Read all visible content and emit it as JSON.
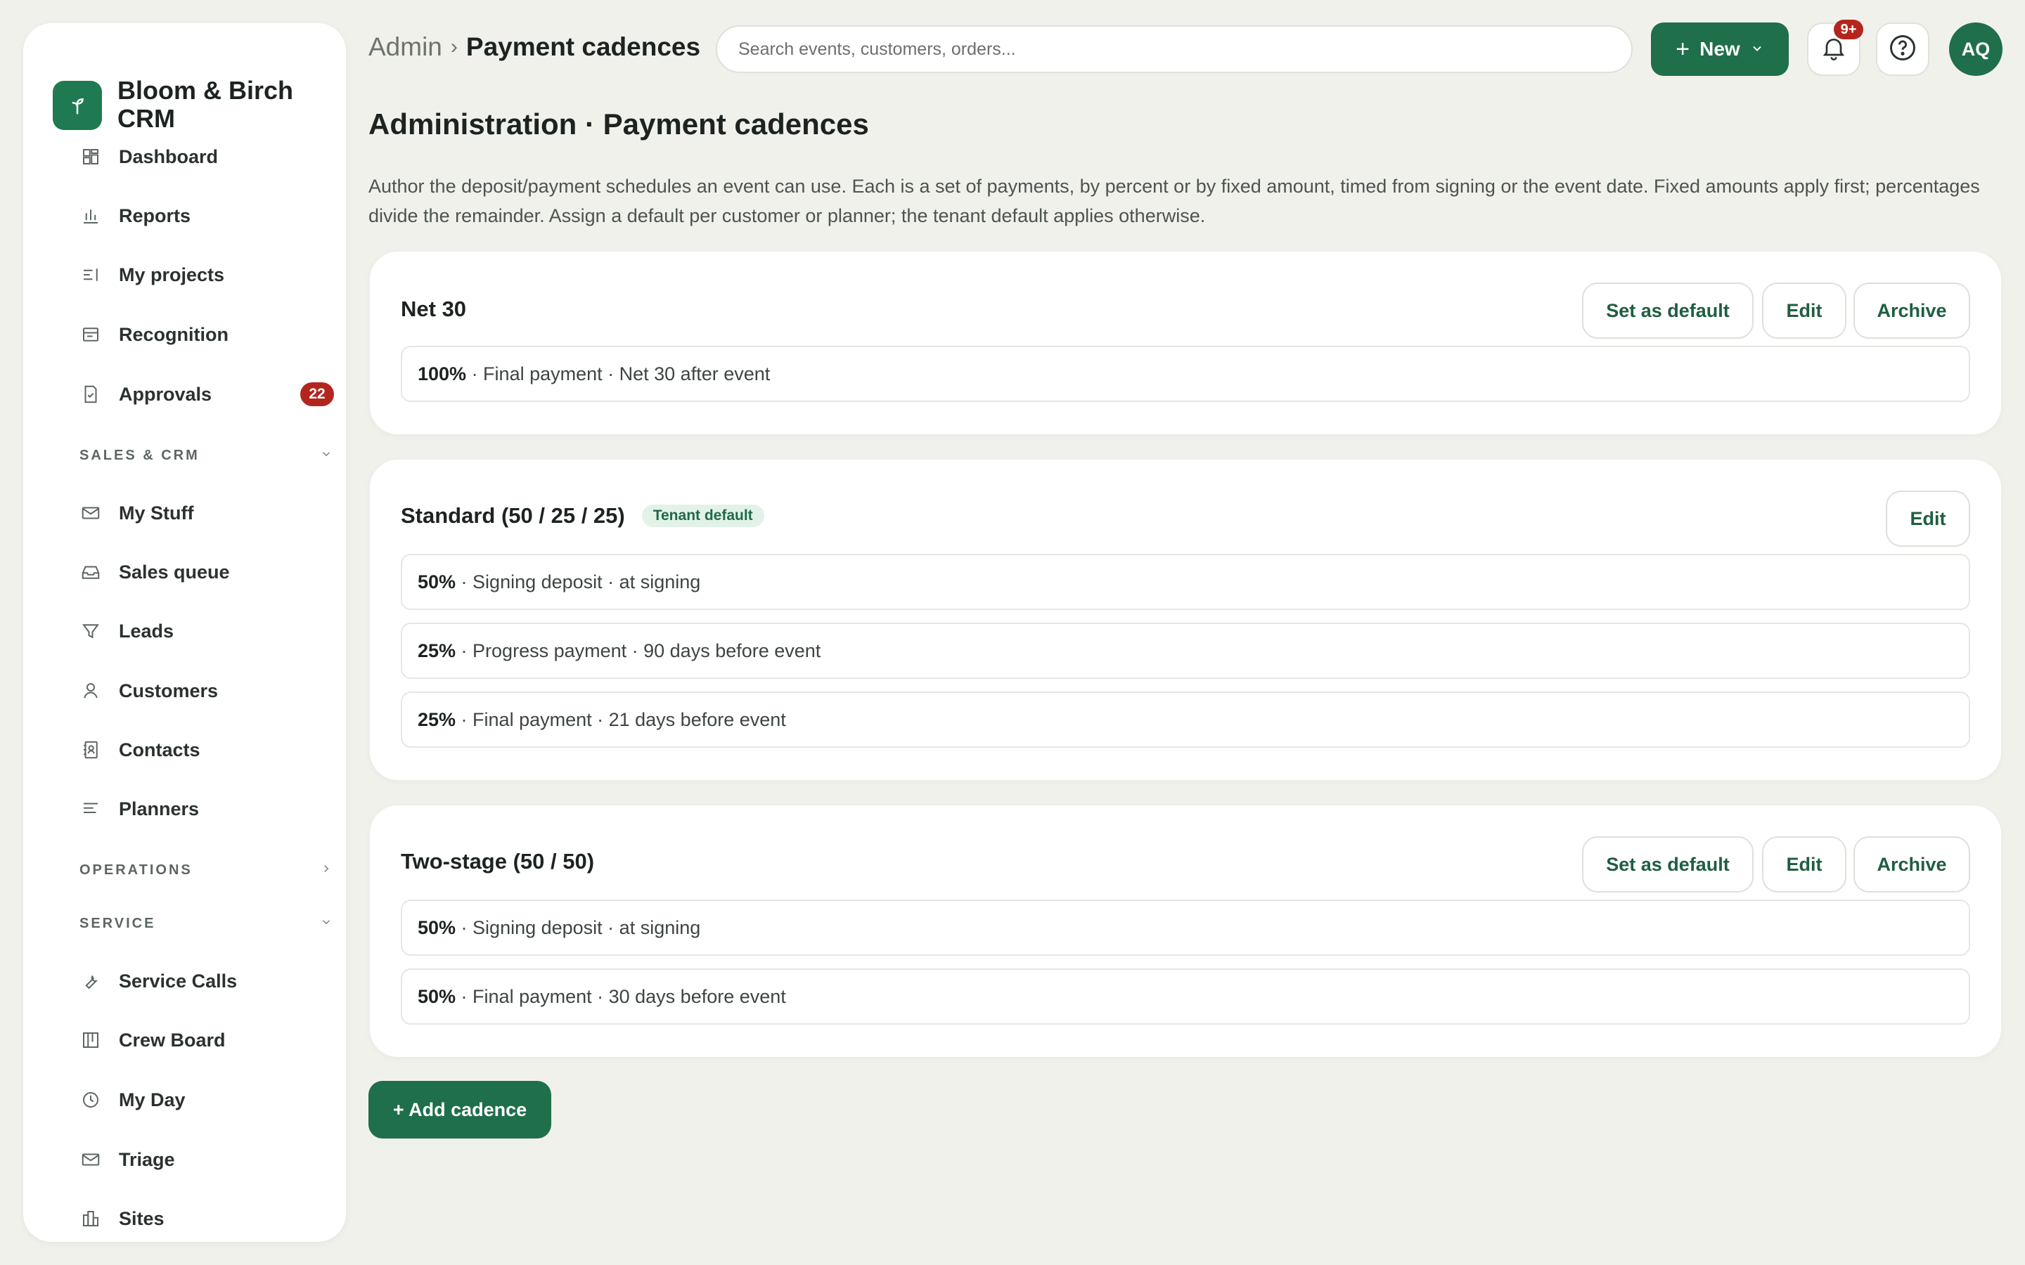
{
  "brand": {
    "name": "Bloom & Birch CRM"
  },
  "sidebar": {
    "items": [
      {
        "label": "Dashboard"
      },
      {
        "label": "Reports"
      },
      {
        "label": "My projects"
      },
      {
        "label": "Recognition"
      },
      {
        "label": "Approvals",
        "badge": "22"
      }
    ],
    "sections": [
      {
        "label": "SALES & CRM",
        "expanded": true,
        "items": [
          {
            "label": "My Stuff"
          },
          {
            "label": "Sales queue"
          },
          {
            "label": "Leads"
          },
          {
            "label": "Customers"
          },
          {
            "label": "Contacts"
          },
          {
            "label": "Planners"
          }
        ]
      },
      {
        "label": "OPERATIONS",
        "expanded": false,
        "items": []
      },
      {
        "label": "SERVICE",
        "expanded": true,
        "items": [
          {
            "label": "Service Calls"
          },
          {
            "label": "Crew Board"
          },
          {
            "label": "My Day"
          },
          {
            "label": "Triage"
          },
          {
            "label": "Sites"
          }
        ]
      }
    ]
  },
  "header": {
    "breadcrumb_root": "Admin",
    "breadcrumb_sep": "›",
    "breadcrumb_current": "Payment cadences",
    "search_placeholder": "Search events, customers, orders...",
    "new_label": "New",
    "notif_badge": "9+",
    "avatar_initials": "AQ"
  },
  "main": {
    "title": "Administration · Payment cadences",
    "description": "Author the deposit/payment schedules an event can use. Each is a set of payments, by percent or by fixed amount, timed from signing or the event date. Fixed amounts apply first; percentages divide the remainder. Assign a default per customer or planner; the tenant default applies otherwise.",
    "cadences": [
      {
        "name": "Net 30",
        "tag": "",
        "actions": {
          "set_default": "Set as default",
          "edit": "Edit",
          "archive": "Archive"
        },
        "payments": [
          {
            "pct": "100%",
            "desc": " · Final payment · Net 30 after event"
          }
        ]
      },
      {
        "name": "Standard (50 / 25 / 25)",
        "tag": "Tenant default",
        "actions": {
          "edit": "Edit"
        },
        "payments": [
          {
            "pct": "50%",
            "desc": " · Signing deposit · at signing"
          },
          {
            "pct": "25%",
            "desc": " · Progress payment · 90 days before event"
          },
          {
            "pct": "25%",
            "desc": " · Final payment · 21 days before event"
          }
        ]
      },
      {
        "name": "Two-stage (50 / 50)",
        "tag": "",
        "actions": {
          "set_default": "Set as default",
          "edit": "Edit",
          "archive": "Archive"
        },
        "payments": [
          {
            "pct": "50%",
            "desc": " · Signing deposit · at signing"
          },
          {
            "pct": "50%",
            "desc": " · Final payment · 30 days before event"
          }
        ]
      }
    ],
    "add_label": "+ Add cadence"
  },
  "colors": {
    "accent": "#1f6f4a",
    "badge": "#b3261e",
    "background": "#f1f1ec"
  }
}
